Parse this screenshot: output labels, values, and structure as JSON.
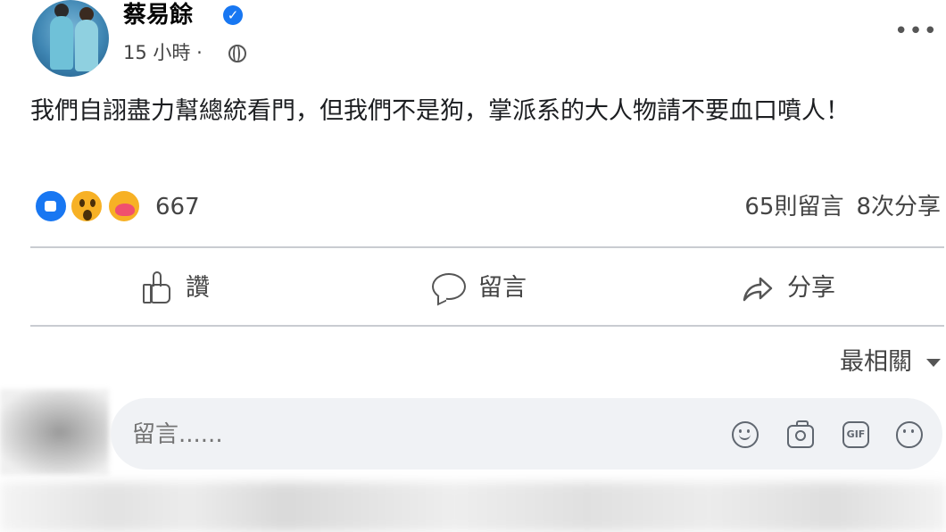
{
  "post": {
    "author": "蔡易餘",
    "verified_icon": "verified-check-icon",
    "timestamp": "15 小時 ·",
    "privacy_icon": "globe-icon",
    "more_icon": "more-options-icon",
    "text": "我們自詡盡力幫總統看門，但我們不是狗，掌派系的大人物請不要血口噴人！",
    "reaction_count": "667",
    "reactions": [
      "like",
      "wow",
      "care"
    ],
    "comments_count": "65則留言",
    "shares_count": "8次分享"
  },
  "actions": {
    "like_label": "讚",
    "comment_label": "留言",
    "share_label": "分享"
  },
  "sort": {
    "label": "最相關"
  },
  "composer": {
    "placeholder": "留言......",
    "icons": [
      "emoji-icon",
      "camera-icon",
      "gif-icon",
      "sticker-icon"
    ],
    "gif_text": "GIF"
  },
  "colors": {
    "accent": "#1877f2",
    "composer_bg": "#f0f2f5",
    "divider": "#c9ccd1",
    "text_secondary": "#444444"
  }
}
